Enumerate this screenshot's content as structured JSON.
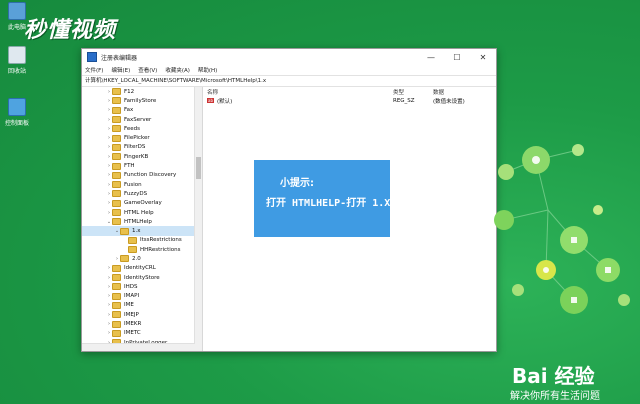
{
  "watermark": "秒懂视频",
  "desktop": {
    "icons": [
      {
        "name": "此电脑",
        "icon": "computer-icon"
      },
      {
        "name": "回收站",
        "icon": "recycle-bin-icon"
      },
      {
        "name": "控制面板",
        "icon": "control-panel-icon"
      }
    ]
  },
  "window": {
    "title": "注册表编辑器",
    "controls": {
      "minimize": "—",
      "maximize": "☐",
      "close": "✕"
    },
    "menu": [
      "文件(F)",
      "编辑(E)",
      "查看(V)",
      "收藏夹(A)",
      "帮助(H)"
    ],
    "address": "计算机\\HKEY_LOCAL_MACHINE\\SOFTWARE\\Microsoft\\HTMLHelp\\1.x",
    "tree": [
      {
        "label": "F12",
        "chev": "›",
        "indent": 0
      },
      {
        "label": "FamilyStore",
        "chev": "›",
        "indent": 0
      },
      {
        "label": "Fax",
        "chev": "›",
        "indent": 0
      },
      {
        "label": "FaxServer",
        "chev": "›",
        "indent": 0
      },
      {
        "label": "Feeds",
        "chev": "›",
        "indent": 0
      },
      {
        "label": "FilePicker",
        "chev": "›",
        "indent": 0
      },
      {
        "label": "FilterDS",
        "chev": "›",
        "indent": 0
      },
      {
        "label": "FingerKB",
        "chev": "›",
        "indent": 0
      },
      {
        "label": "FTH",
        "chev": "›",
        "indent": 0
      },
      {
        "label": "Function Discovery",
        "chev": "›",
        "indent": 0
      },
      {
        "label": "Fusion",
        "chev": "›",
        "indent": 0
      },
      {
        "label": "FuzzyDS",
        "chev": "›",
        "indent": 0
      },
      {
        "label": "GameOverlay",
        "chev": "›",
        "indent": 0
      },
      {
        "label": "HTML Help",
        "chev": "›",
        "indent": 0
      },
      {
        "label": "HTMLHelp",
        "chev": "⌄",
        "indent": 0
      },
      {
        "label": "1.x",
        "chev": "⌄",
        "indent": 1,
        "selected": true
      },
      {
        "label": "ItssRestrictions",
        "chev": "",
        "indent": 2
      },
      {
        "label": "HHRestrictions",
        "chev": "",
        "indent": 2
      },
      {
        "label": "2.0",
        "chev": "›",
        "indent": 1
      },
      {
        "label": "IdentityCRL",
        "chev": "›",
        "indent": 0
      },
      {
        "label": "IdentityStore",
        "chev": "›",
        "indent": 0
      },
      {
        "label": "IHDS",
        "chev": "›",
        "indent": 0
      },
      {
        "label": "IMAPI",
        "chev": "›",
        "indent": 0
      },
      {
        "label": "IME",
        "chev": "›",
        "indent": 0
      },
      {
        "label": "IMEJP",
        "chev": "›",
        "indent": 0
      },
      {
        "label": "IMEKR",
        "chev": "›",
        "indent": 0
      },
      {
        "label": "IMETC",
        "chev": "›",
        "indent": 0
      },
      {
        "label": "InPrivateLogger",
        "chev": "›",
        "indent": 0
      },
      {
        "label": "Input",
        "chev": "›",
        "indent": 0
      }
    ],
    "values_header": {
      "name": "名称",
      "type": "类型",
      "data": "数据"
    },
    "values": [
      {
        "name": "(默认)",
        "type": "REG_SZ",
        "data": "(数值未设置)"
      }
    ]
  },
  "tip": {
    "heading": "小提示:",
    "text": "打开 HTMLHELP-打开 1.X"
  },
  "brand": {
    "logo": "Bai 经验",
    "tagline": "解决你所有生活问题"
  },
  "colors": {
    "desktop_bg": "#1c9a45",
    "tip_bg": "#3f9be3",
    "folder": "#e8c04c"
  }
}
